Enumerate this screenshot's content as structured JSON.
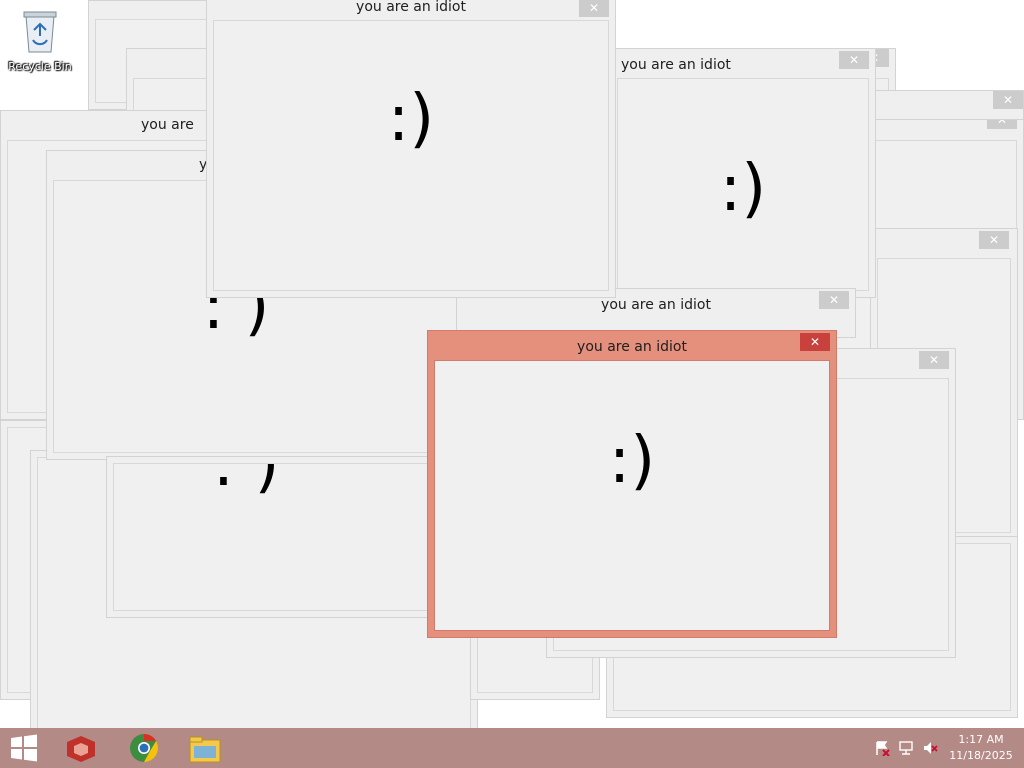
{
  "desktop": {
    "recycle_bin_label": "Recycle Bin",
    "popup_title": "you are an idiot",
    "popup_title_partial_1": "you are",
    "popup_title_partial_2": "y",
    "popup_title_partial_3": "ot",
    "smiley": ":)",
    "smiley_partial": ": )",
    "close_glyph": "✕"
  },
  "taskbar": {
    "time": "1:17 AM",
    "date": "11/18/2025",
    "pinned": [
      "start",
      "app-red",
      "chrome",
      "file-explorer"
    ]
  },
  "colors": {
    "taskbar_bg": "#b48a87",
    "active_frame": "#e5907c",
    "inactive_frame": "#efefef",
    "close_active": "#c9413c",
    "close_inactive": "#cccccc"
  }
}
